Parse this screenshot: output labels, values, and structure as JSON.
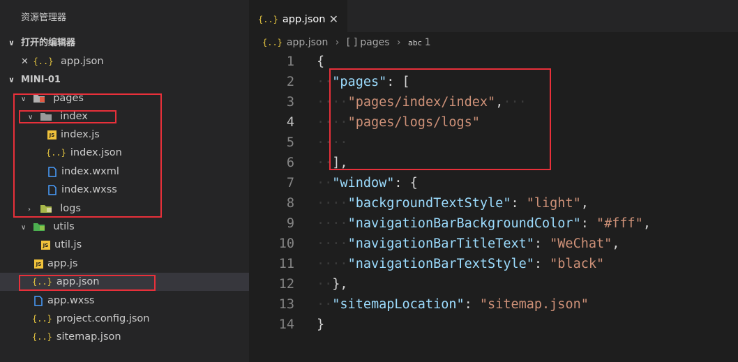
{
  "sidebar": {
    "title": "资源管理器",
    "open_editors": {
      "label": "打开的编辑器",
      "items": [
        {
          "close": "✕",
          "icon": "{..}",
          "name": "app.json"
        }
      ]
    },
    "project": {
      "label": "MINI-01",
      "tree": {
        "pages": "pages",
        "index": "index",
        "index_js": "index.js",
        "index_json": "index.json",
        "index_wxml": "index.wxml",
        "index_wxss": "index.wxss",
        "logs": "logs",
        "utils": "utils",
        "util_js": "util.js",
        "app_js": "app.js",
        "app_json": "app.json",
        "app_wxss": "app.wxss",
        "project_config": "project.config.json",
        "sitemap": "sitemap.json"
      }
    }
  },
  "editor": {
    "tab": {
      "icon": "{..}",
      "label": "app.json",
      "close": "✕"
    },
    "breadcrumb": {
      "icon": "{..}",
      "file": "app.json",
      "sep": "›",
      "array_icon": "[ ]",
      "key": "pages",
      "abc": "abc",
      "value": "1"
    },
    "line_numbers": [
      "1",
      "2",
      "3",
      "4",
      "5",
      "6",
      "7",
      "8",
      "9",
      "10",
      "11",
      "12",
      "13",
      "14"
    ],
    "code": {
      "l1_brace": "{",
      "pages_key": "\"pages\"",
      "pages_colon": ": [",
      "p1": "\"pages/index/index\"",
      "p1_comma": ",",
      "p2": "\"pages/logs/logs\"",
      "close_bracket": "],",
      "window_key": "\"window\"",
      "window_open": ": {",
      "bts_key": "\"backgroundTextStyle\"",
      "bts_val": "\"light\"",
      "nbbc_key": "\"navigationBarBackgroundColor\"",
      "nbbc_val": "\"#fff\"",
      "nbtt_key": "\"navigationBarTitleText\"",
      "nbtt_val": "\"WeChat\"",
      "nbts_key": "\"navigationBarTextStyle\"",
      "nbts_val": "\"black\"",
      "close_obj": "},",
      "sitemap_key": "\"sitemapLocation\"",
      "sitemap_val": "\"sitemap.json\"",
      "end_brace": "}",
      "colon": ": ",
      "comma": ","
    }
  },
  "colors": {
    "highlight_box": "#e8303a",
    "json_icon": "#e6c640",
    "js_icon": "#f0c23b",
    "key": "#9cdcfe",
    "string": "#ce9178"
  }
}
